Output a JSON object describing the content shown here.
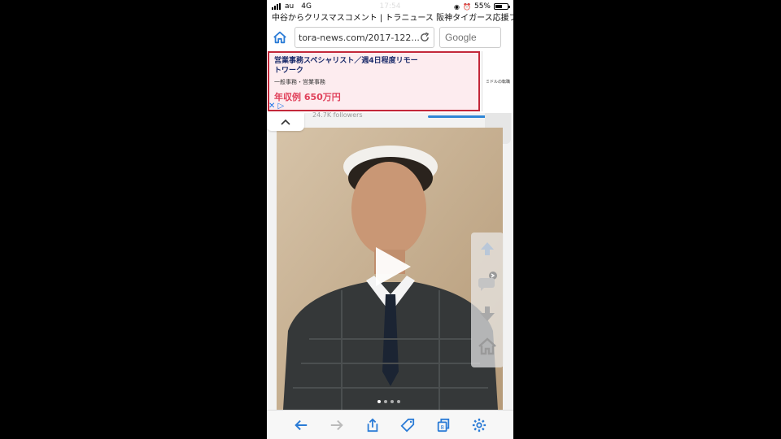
{
  "status_bar": {
    "carrier": "au",
    "network": "4G",
    "time": "17:54",
    "battery_percent": "55%",
    "battery_level": 0.55
  },
  "page": {
    "title": "中谷からクリスマスコメント | トラニュース 阪神タイガース応援ファ..."
  },
  "browser": {
    "url": "tora-news.com/2017-122...",
    "search_placeholder": "Google"
  },
  "ad": {
    "title": "営業事務スペシャリスト／週4日程度リモートワーク",
    "subtitle": "一般事務・営業事務",
    "salary": "年収例 650万円",
    "side_brand": "ミドルの転職"
  },
  "content": {
    "followers": "24.7K followers",
    "carousel_pages": 4,
    "carousel_active": 0
  },
  "icons": {
    "home": "home-icon",
    "reload": "reload-icon",
    "play": "play-icon",
    "back": "back-arrow-icon",
    "forward": "forward-arrow-icon",
    "share": "share-icon",
    "tag": "tag-icon",
    "tabs": "tabs-icon",
    "settings": "gear-icon"
  },
  "colors": {
    "accent": "#2a7bd6",
    "ad_border": "#c3283a",
    "ad_background": "#fdecef",
    "ad_price": "#e0405a"
  }
}
